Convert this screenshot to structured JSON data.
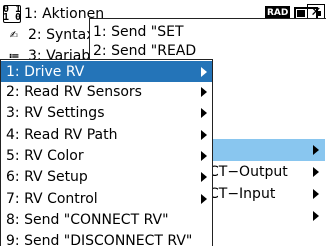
{
  "status": {
    "angle_mode": "RAD"
  },
  "main_menu": {
    "items": [
      {
        "label": "1: Aktionen",
        "icon": "actions-icon",
        "icon_text": "0 1\n1 0"
      },
      {
        "label": "2: Syntax",
        "icon": "syntax-check-icon",
        "icon_text": "✍"
      },
      {
        "label": "3: Variable",
        "icon": "variables-icon",
        "icon_text": "≔"
      }
    ]
  },
  "sub_menu": {
    "items": [
      {
        "label": "1: Send \"SET",
        "has_submenu": false
      },
      {
        "label": "2: Send \"READ",
        "has_submenu": false
      },
      {
        "label": "",
        "has_submenu": false
      },
      {
        "label": "",
        "has_submenu": false
      },
      {
        "label": "",
        "has_submenu": false
      },
      {
        "label": "",
        "has_submenu": true,
        "highlighted": true
      },
      {
        "label": "CT−Output",
        "has_submenu": true
      },
      {
        "label": "CT−Input",
        "has_submenu": true
      },
      {
        "label": "",
        "has_submenu": true
      }
    ]
  },
  "focus_menu": {
    "items": [
      {
        "label": "1: Drive RV",
        "has_submenu": true,
        "selected": true
      },
      {
        "label": "2: Read RV Sensors",
        "has_submenu": true
      },
      {
        "label": "3: RV Settings",
        "has_submenu": true
      },
      {
        "label": "4: Read RV Path",
        "has_submenu": true
      },
      {
        "label": "5: RV Color",
        "has_submenu": true
      },
      {
        "label": "6: RV Setup",
        "has_submenu": true
      },
      {
        "label": "7: RV Control",
        "has_submenu": true
      },
      {
        "label": "8: Send \"CONNECT RV\"",
        "has_submenu": false
      },
      {
        "label": "9: Send \"DISCONNECT RV\"",
        "has_submenu": false
      }
    ]
  }
}
